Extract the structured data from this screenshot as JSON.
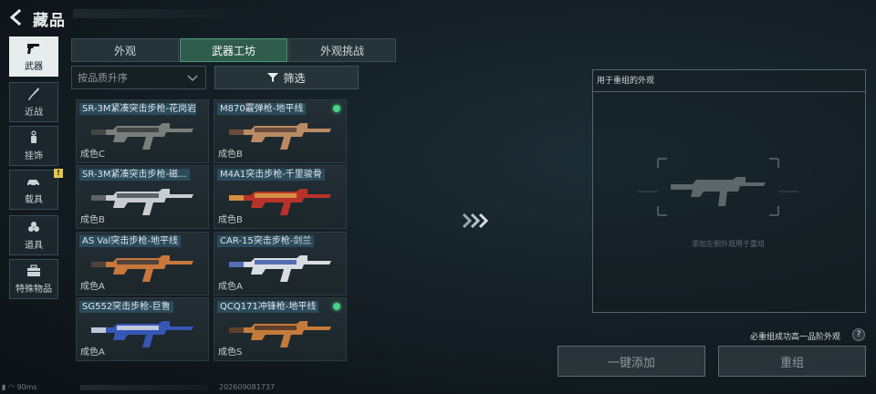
{
  "header": {
    "title": "藏品"
  },
  "nav": [
    {
      "label": "武器",
      "icon": "pistol-icon",
      "active": true
    },
    {
      "label": "近战",
      "icon": "knife-icon"
    },
    {
      "label": "挂饰",
      "icon": "charm-icon"
    },
    {
      "label": "载具",
      "icon": "vehicle-icon",
      "badge": "!"
    },
    {
      "label": "道具",
      "icon": "grenade-icon"
    },
    {
      "label": "特殊物品",
      "icon": "toolbox-icon"
    }
  ],
  "tabs": [
    {
      "label": "外观"
    },
    {
      "label": "武器工坊",
      "active": true
    },
    {
      "label": "外观挑战"
    }
  ],
  "sort": {
    "value": "按品质升序"
  },
  "filter": {
    "label": "筛选"
  },
  "cards": [
    {
      "name": "SR-3M紧凑突击步枪-花岗岩",
      "grade": "成色C",
      "new": false,
      "colors": [
        "#7a7f7c",
        "#3a3c3b"
      ]
    },
    {
      "name": "M870霰弹枪-地平线",
      "grade": "成色B",
      "new": true,
      "colors": [
        "#b98a64",
        "#5a4136"
      ]
    },
    {
      "name": "SR-3M紧凑突击步枪-磁...",
      "grade": "成色B",
      "new": false,
      "colors": [
        "#c9ccd1",
        "#4a4f56"
      ]
    },
    {
      "name": "M4A1突击步枪-千里骏骨",
      "grade": "成色B",
      "new": false,
      "colors": [
        "#b8322a",
        "#d8a048"
      ]
    },
    {
      "name": "AS Val突击步枪-地平线",
      "grade": "成色A",
      "new": false,
      "colors": [
        "#c8783a",
        "#3a3a3c"
      ]
    },
    {
      "name": "CAR-15突击步枪-剑兰",
      "grade": "成色A",
      "new": false,
      "colors": [
        "#d9dce2",
        "#3c5aa8"
      ]
    },
    {
      "name": "SG552突击步枪-巨鲁",
      "grade": "成色A",
      "new": false,
      "colors": [
        "#3657b5",
        "#d8dbe2"
      ]
    },
    {
      "name": "QCQ171冲锋枪-地平线",
      "grade": "成色S",
      "new": true,
      "colors": [
        "#c47a3a",
        "#4a362a"
      ]
    }
  ],
  "panel": {
    "title": "用于重组的外观",
    "hint": "添加左侧外观用于重组"
  },
  "note": "必重组成功高一品阶外观",
  "buttons": {
    "add_all": "一键添加",
    "recombine": "重组"
  },
  "status": {
    "ping": "90ms",
    "uid": "202609081737"
  },
  "colors": {
    "accent": "#4f9a7c",
    "new_dot": "#4bd08a",
    "badge": "#e5c84a"
  }
}
